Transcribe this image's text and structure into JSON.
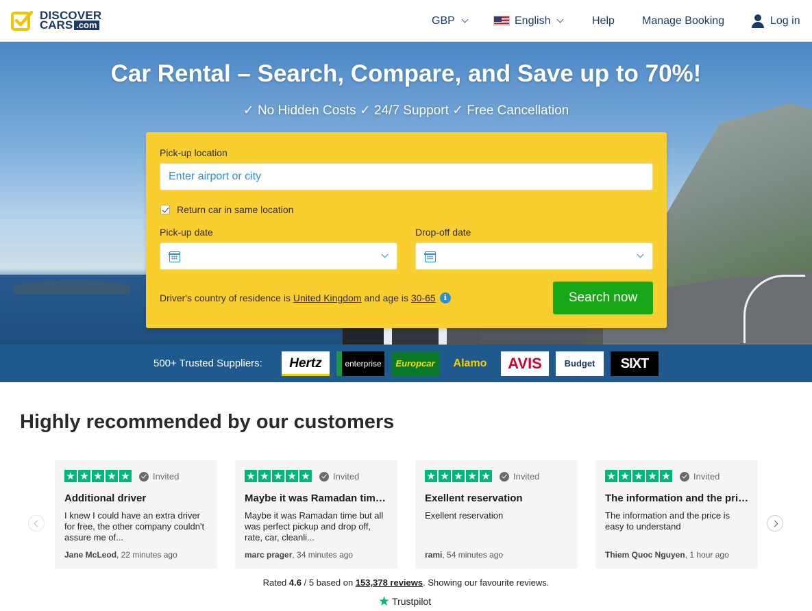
{
  "header": {
    "logo": {
      "line1": "DISCOVER",
      "line2": "CARS",
      "suffix": ".com"
    },
    "currency": "GBP",
    "language": "English",
    "help": "Help",
    "manage_booking": "Manage Booking",
    "login": "Log in"
  },
  "hero": {
    "title": "Car Rental – Search, Compare, and Save up to 70%!",
    "subtitle": "✓ No Hidden Costs ✓ 24/7 Support ✓ Free Cancellation"
  },
  "search": {
    "pickup_label": "Pick-up location",
    "pickup_placeholder": "Enter airport or city",
    "return_same_label": "Return car in same location",
    "return_same_checked": true,
    "pickup_date_label": "Pick-up date",
    "dropoff_date_label": "Drop-off date",
    "residence_prefix": "Driver's country of residence is",
    "residence_country": "United Kingdom",
    "age_prefix": "and age is",
    "age_range": "30-65",
    "info_glyph": "i",
    "button": "Search now"
  },
  "suppliers": {
    "label": "500+ Trusted Suppliers:",
    "brands": [
      "Hertz",
      "enterprise",
      "Europcar",
      "Alamo",
      "AVIS",
      "Budget",
      "SIXT"
    ]
  },
  "reviews": {
    "title": "Highly recommended by our customers",
    "cards": [
      {
        "badge": "Invited",
        "title": "Additional driver",
        "body": "I knew I could have an extra driver for free, the other company couldn't assure me of...",
        "author": "Jane McLeod",
        "time": ", 22 minutes ago",
        "stars": 5
      },
      {
        "badge": "Invited",
        "title": "Maybe it was Ramadan time ...",
        "body": "Maybe it was Ramadan time but all was perfect pickup and drop off, rate, car, cleanli...",
        "author": "marc prager",
        "time": ", 34 minutes ago",
        "stars": 5
      },
      {
        "badge": "Invited",
        "title": "Exellent reservation",
        "body": "Exellent reservation",
        "author": "rami",
        "time": ", 54 minutes ago",
        "stars": 5
      },
      {
        "badge": "Invited",
        "title": "The information and the pric...",
        "body": "The information and the price is easy to understand",
        "author": "Thiem Quoc Nguyen",
        "time": ", 1 hour ago",
        "stars": 5
      }
    ],
    "rated_prefix": "Rated",
    "rating": "4.6",
    "rated_mid": "/ 5 based on",
    "count": "153,378 reviews",
    "rated_suffix": ". Showing our favourite reviews.",
    "trustpilot": "Trustpilot"
  },
  "colors": {
    "brand_navy": "#1b3a63",
    "search_yellow": "#f8cf2e",
    "cta_green": "#18a817",
    "trustpilot_green": "#00b67a",
    "band_blue": "#1e5a8d"
  }
}
